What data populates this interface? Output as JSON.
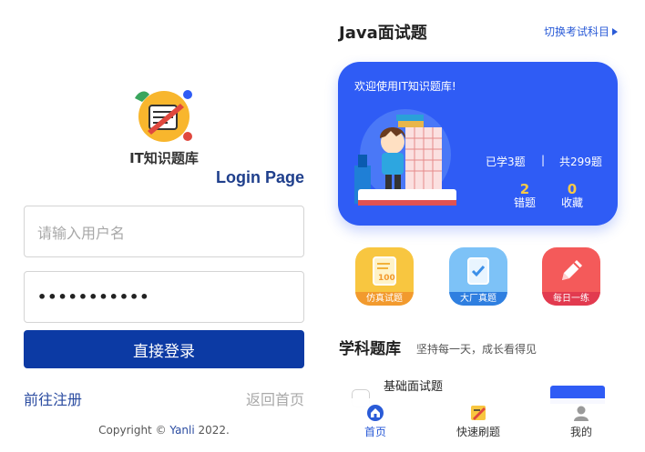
{
  "login": {
    "app_name": "IT知识题库",
    "heading": "Login Page",
    "username_placeholder": "请输入用户名",
    "password_value": "•••••••••••",
    "login_button": "直接登录",
    "register_link": "前往注册",
    "home_link": "返回首页",
    "copyright_prefix": "Copyright © ",
    "copyright_owner": "Yanli",
    "copyright_year": " 2022."
  },
  "bank": {
    "title": "Java面试题",
    "switch_subject": "切换考试科目",
    "hero": {
      "welcome": "欢迎使用IT知识题库!",
      "learned": "已学3题",
      "divider": "|",
      "total": "共299题",
      "wrong_count": "2",
      "wrong_label": "错题",
      "favorite_count": "0",
      "favorite_label": "收藏"
    },
    "shortcuts": [
      {
        "label": "仿真试题",
        "icon": "exam-paper-icon",
        "color": "#f8c640"
      },
      {
        "label": "大厂真题",
        "icon": "checklist-icon",
        "color": "#7dc2f7"
      },
      {
        "label": "每日一练",
        "icon": "pencil-icon",
        "color": "#f45a5a"
      }
    ],
    "section": {
      "title": "学科题库",
      "subtitle": "坚持每一天，成长看得见"
    },
    "subject_card": {
      "title": "基础面试题"
    },
    "tabs": [
      {
        "label": "首页",
        "icon": "home-icon",
        "active": true
      },
      {
        "label": "快速刷题",
        "icon": "practice-icon",
        "active": false
      },
      {
        "label": "我的",
        "icon": "user-icon",
        "active": false
      }
    ]
  },
  "colors": {
    "primary_blue": "#2f5cf5",
    "login_button": "#0c3aa4",
    "link_blue": "#2a4ba0",
    "stat_yellow": "#f7c948"
  }
}
